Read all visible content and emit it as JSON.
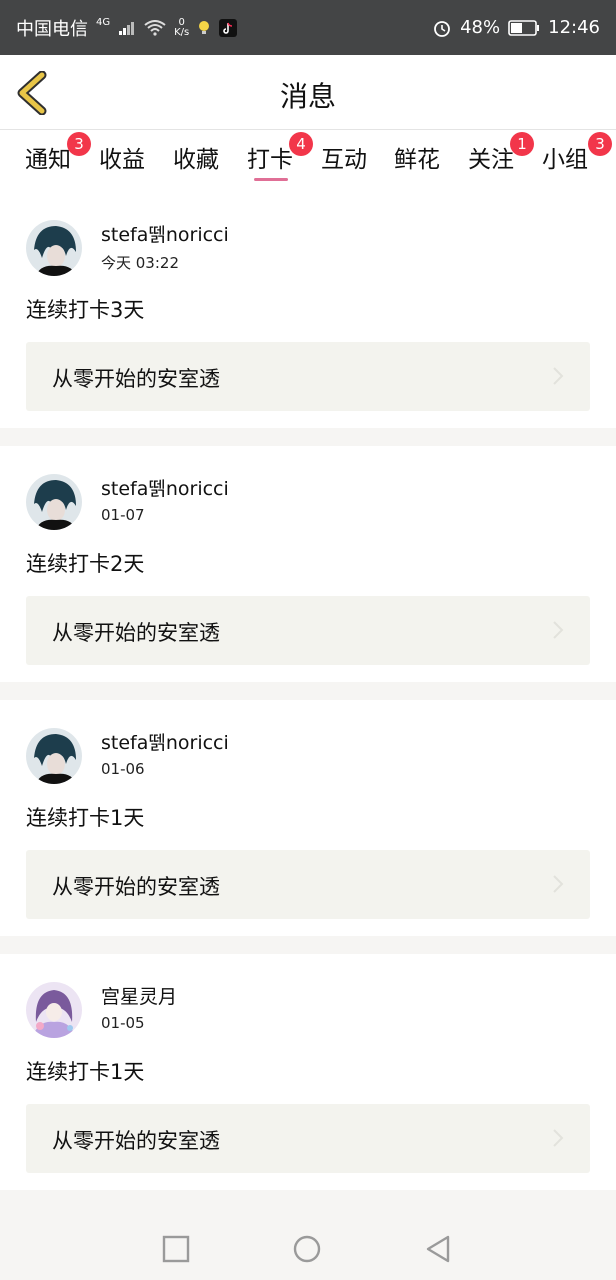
{
  "status_bar": {
    "carrier": "中国电信",
    "network_type": "4G",
    "speed_value": "0",
    "speed_unit": "K/s",
    "battery": "48%",
    "time": "12:46"
  },
  "header": {
    "title": "消息",
    "back_icon": "chevron-left-icon",
    "accent_color": "#e8c547"
  },
  "tabs": [
    {
      "label": "通知",
      "badge": "3"
    },
    {
      "label": "收益",
      "badge": ""
    },
    {
      "label": "收藏",
      "badge": ""
    },
    {
      "label": "打卡",
      "badge": "4",
      "active": true
    },
    {
      "label": "互动",
      "badge": ""
    },
    {
      "label": "鲜花",
      "badge": ""
    },
    {
      "label": "关注",
      "badge": "1"
    },
    {
      "label": "小组",
      "badge": "3"
    }
  ],
  "messages": [
    {
      "user": "stefa뗅noricci",
      "time": "今天 03:22",
      "text": "连续打卡3天",
      "link": "从零开始的安室透"
    },
    {
      "user": "stefa뗅noricci",
      "time": "01-07",
      "text": "连续打卡2天",
      "link": "从零开始的安室透"
    },
    {
      "user": "stefa뗅noricci",
      "time": "01-06",
      "text": "连续打卡1天",
      "link": "从零开始的安室透"
    },
    {
      "user": "宫星灵月",
      "time": "01-05",
      "text": "连续打卡1天",
      "link": "从零开始的安室透"
    }
  ],
  "colors": {
    "badge": "#f2364a",
    "active_tab_underline": "#e06f96",
    "link_bg": "#f3f3ee"
  }
}
